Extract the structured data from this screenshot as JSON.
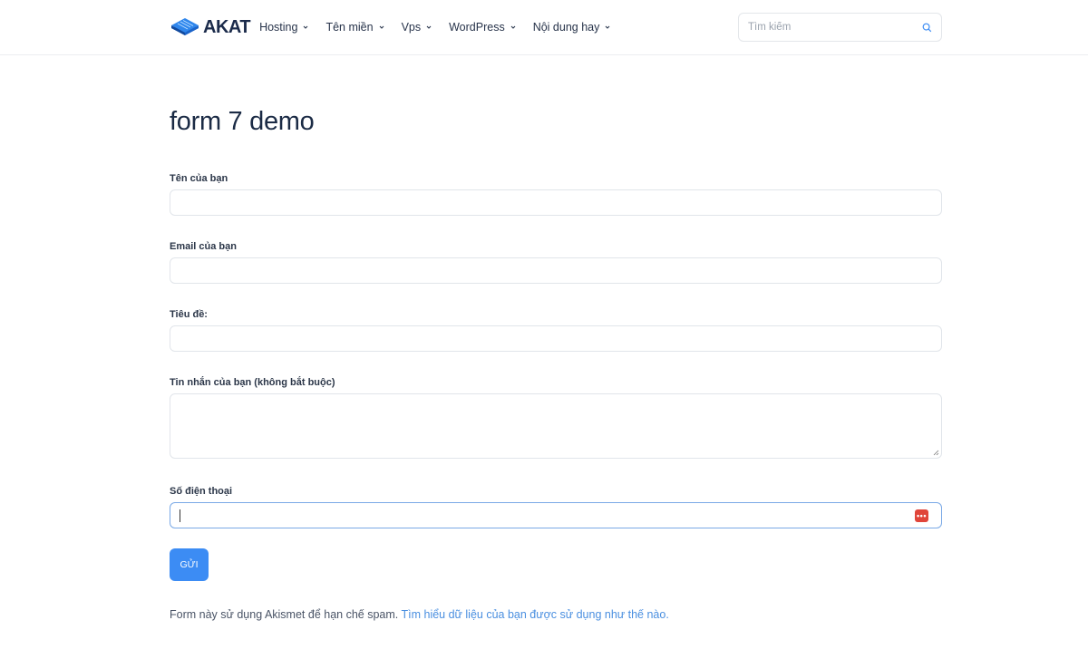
{
  "header": {
    "logo_text": "AKAT",
    "nav": [
      {
        "label": "Hosting"
      },
      {
        "label": "Tên miền"
      },
      {
        "label": "Vps"
      },
      {
        "label": "WordPress"
      },
      {
        "label": "Nội dung hay"
      }
    ],
    "search": {
      "placeholder": "Tìm kiếm",
      "value": ""
    }
  },
  "main": {
    "title": "form 7 demo",
    "form": {
      "name": {
        "label": "Tên của bạn",
        "value": ""
      },
      "email": {
        "label": "Email của bạn",
        "value": ""
      },
      "subject": {
        "label": "Tiêu đề:",
        "value": ""
      },
      "message": {
        "label": "Tin nhắn của bạn (không bắt buộc)",
        "value": ""
      },
      "phone": {
        "label": "Số điện thoại",
        "value": ""
      },
      "submit_label": "GỬI"
    },
    "footnote": {
      "text": "Form này sử dụng Akismet để hạn chế spam.",
      "link": "Tìm hiểu dữ liệu của bạn được sử dụng như thế nào."
    }
  },
  "colors": {
    "accent": "#3c8cf4",
    "link": "#4a8fe0",
    "badge": "#e0453a"
  },
  "icons": [
    "logo-mark-icon",
    "chevron-down-icon",
    "search-icon",
    "password-manager-icon",
    "resize-handle-icon"
  ]
}
